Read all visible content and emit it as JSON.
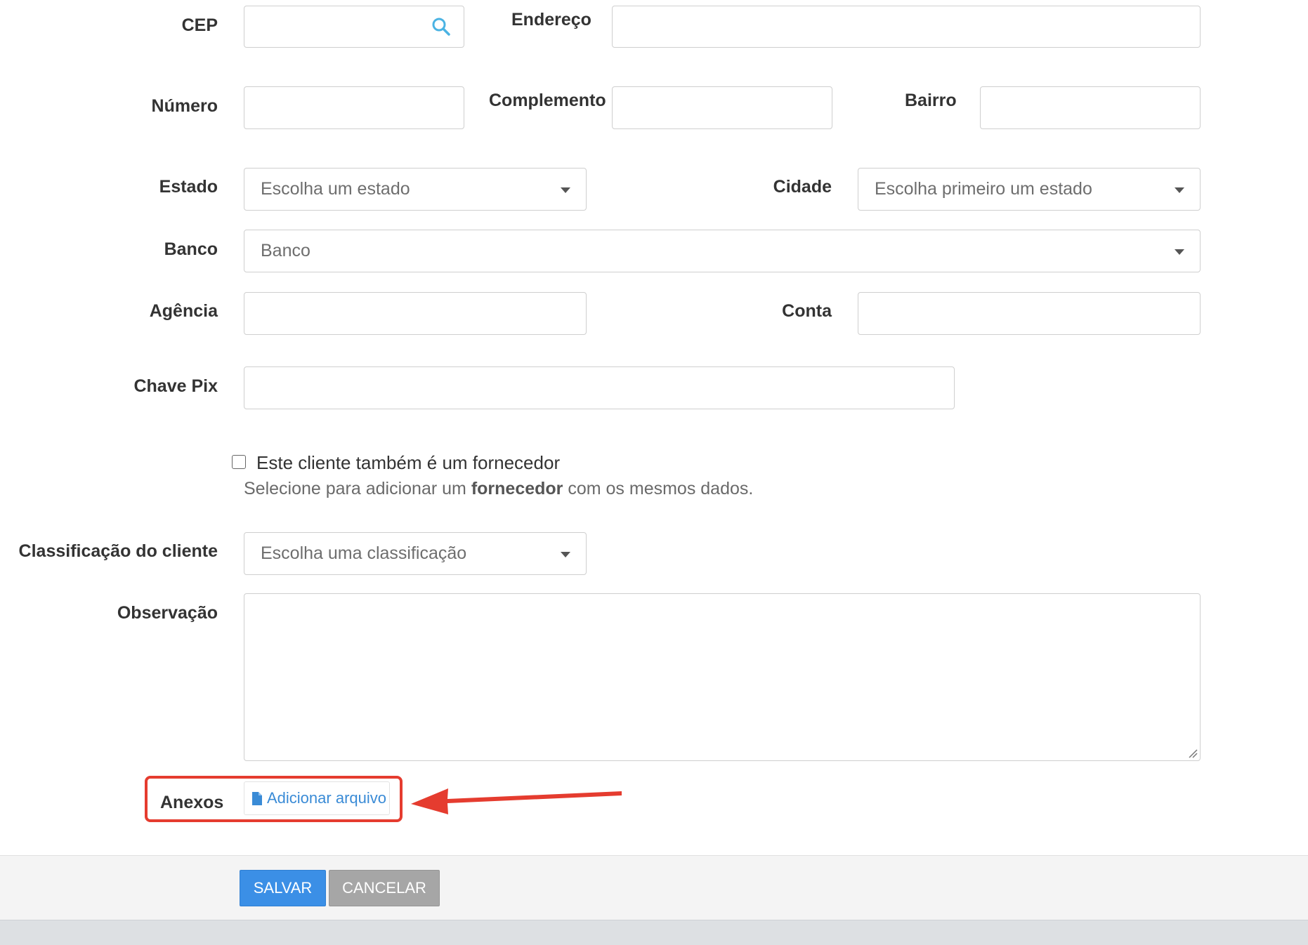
{
  "form": {
    "cep": {
      "label": "CEP",
      "value": ""
    },
    "endereco": {
      "label": "Endereço",
      "value": ""
    },
    "numero": {
      "label": "Número",
      "value": ""
    },
    "complemento": {
      "label": "Complemento",
      "value": ""
    },
    "bairro": {
      "label": "Bairro",
      "value": ""
    },
    "estado": {
      "label": "Estado",
      "selected": "Escolha um estado"
    },
    "cidade": {
      "label": "Cidade",
      "selected": "Escolha primeiro um estado"
    },
    "banco": {
      "label": "Banco",
      "selected": "Banco"
    },
    "agencia": {
      "label": "Agência",
      "value": ""
    },
    "conta": {
      "label": "Conta",
      "value": ""
    },
    "chave_pix": {
      "label": "Chave Pix",
      "value": ""
    },
    "fornecedor": {
      "checkbox_label": "Este cliente também é um fornecedor",
      "checked": false,
      "help_prefix": "Selecione para adicionar um ",
      "help_bold": "fornecedor",
      "help_suffix": " com os mesmos dados."
    },
    "classificacao": {
      "label": "Classificação do cliente",
      "selected": "Escolha uma classificação"
    },
    "observacao": {
      "label": "Observação",
      "value": ""
    },
    "anexos": {
      "label": "Anexos",
      "button_label": "Adicionar arquivo"
    }
  },
  "actions": {
    "save_label": "SALVAR",
    "cancel_label": "CANCELAR"
  },
  "colors": {
    "primary": "#3b8fe6",
    "secondary": "#a6a6a6",
    "link": "#3a8bd6",
    "highlight": "#e53c2f"
  },
  "icons": {
    "search": "search-icon",
    "file": "file-icon",
    "arrow": "red-arrow-annotation"
  }
}
